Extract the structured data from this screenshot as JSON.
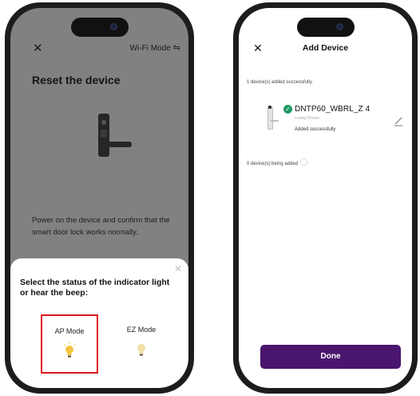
{
  "left_screen": {
    "header": {
      "close_icon": "close-icon",
      "mode_label": "Wi-Fi Mode",
      "mode_icon": "swap-icon"
    },
    "title": "Reset the device",
    "description": "Power on the device and confirm that the smart door lock works normally.",
    "sheet": {
      "title": "Select the status of the indicator light or hear the beep:",
      "options": [
        {
          "label": "AP Mode",
          "icon": "bulb-icon",
          "selected": true
        },
        {
          "label": "EZ Mode",
          "icon": "bulb-icon",
          "selected": false
        }
      ]
    }
  },
  "right_screen": {
    "header": {
      "title": "Add Device",
      "close_icon": "close-icon"
    },
    "added_count_text": "1 device(s) added successfully",
    "device": {
      "name": "DNTP60_WBRL_Z 4",
      "room": "Living Room",
      "status": "Added successfully",
      "edit_icon": "pencil-icon"
    },
    "adding_text": "0 device(s) being added",
    "done_label": "Done"
  },
  "colors": {
    "accent_purple": "#4a166d",
    "success_green": "#1f9a64",
    "highlight_red": "#e01818",
    "bulb_on": "#f5c542",
    "bulb_off": "#f1dfa8"
  }
}
